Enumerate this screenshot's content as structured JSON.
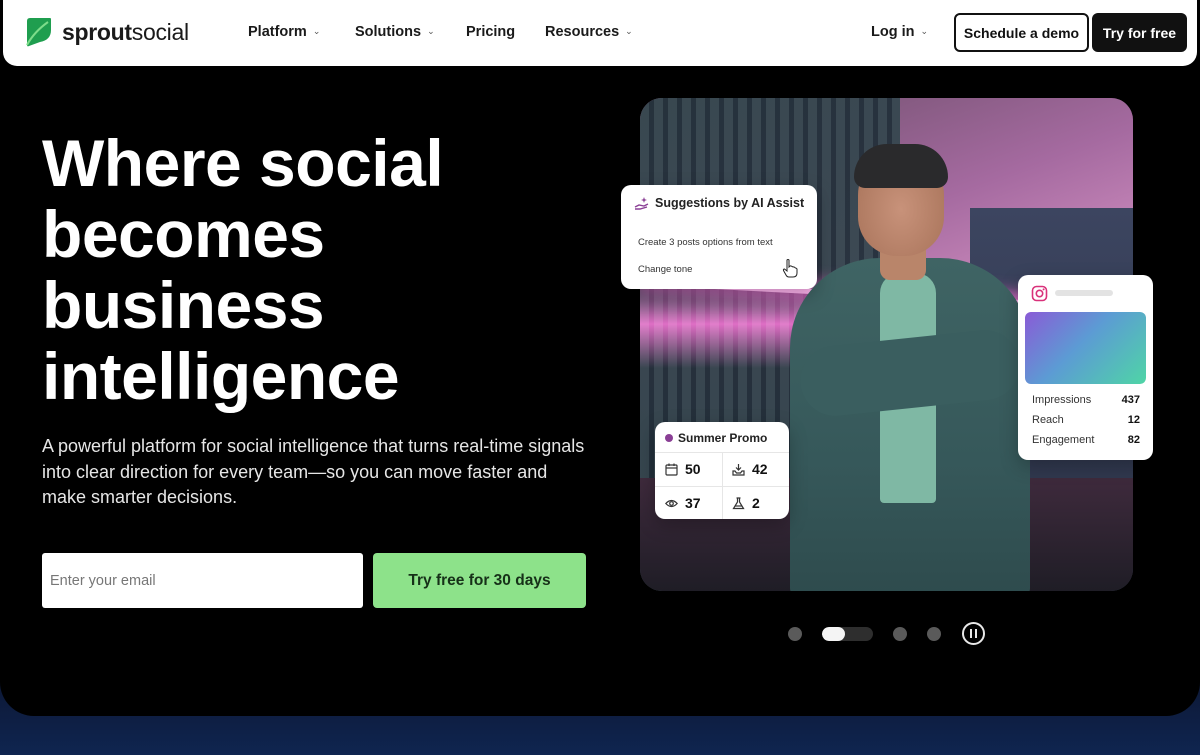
{
  "brand": {
    "name_part1": "sprout",
    "name_part2": "social",
    "accent": "#1f9e4f"
  },
  "nav": {
    "items": [
      {
        "label": "Platform",
        "has_dropdown": true
      },
      {
        "label": "Solutions",
        "has_dropdown": true
      },
      {
        "label": "Pricing",
        "has_dropdown": false
      },
      {
        "label": "Resources",
        "has_dropdown": true
      }
    ],
    "login_label": "Log in",
    "demo_label": "Schedule a demo",
    "try_label": "Try for free"
  },
  "hero": {
    "title_lines": [
      "Where social",
      "becomes",
      "business",
      "intelligence"
    ],
    "subtitle": "A powerful platform for social intelligence that turns real-time signals into clear direction for every team—so you can move faster and make smarter decisions.",
    "email_placeholder": "Enter your email",
    "cta_label": "Try free for 30 days",
    "cta_color": "#8de28a"
  },
  "ai_card": {
    "title": "Suggestions by AI Assist",
    "options": [
      "Create 3 posts options from text",
      "Change tone"
    ]
  },
  "instagram_card": {
    "metrics": [
      {
        "label": "Impressions",
        "value": "437"
      },
      {
        "label": "Reach",
        "value": "12"
      },
      {
        "label": "Engagement",
        "value": "82"
      }
    ]
  },
  "promo_card": {
    "title": "Summer Promo",
    "stats": [
      {
        "icon": "calendar-icon",
        "value": "50"
      },
      {
        "icon": "inbox-icon",
        "value": "42"
      },
      {
        "icon": "eye-icon",
        "value": "37"
      },
      {
        "icon": "flask-icon",
        "value": "2"
      }
    ]
  },
  "carousel": {
    "slide_count": 4,
    "active_index": 1,
    "active_progress": 0.45
  }
}
